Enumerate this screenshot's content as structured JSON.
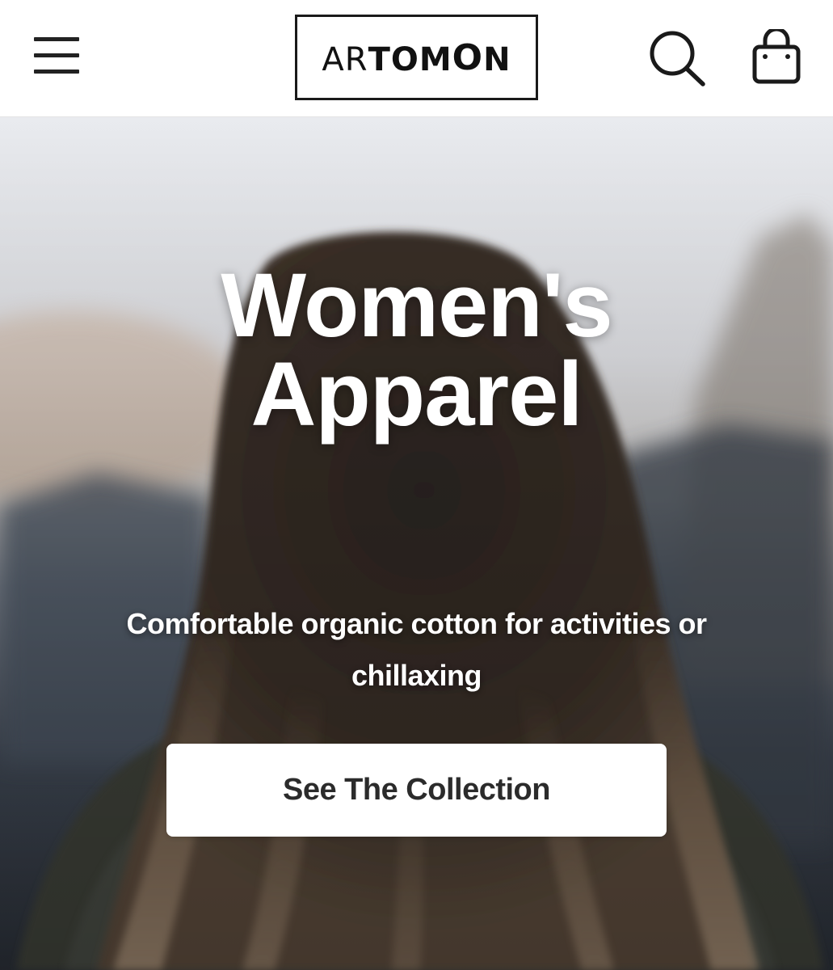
{
  "header": {
    "menu_icon": "hamburger-menu-icon",
    "logo": {
      "text": "ARTOMON",
      "parts": [
        "AR",
        "TOM",
        "O",
        "N"
      ]
    },
    "search_icon": "search-icon",
    "cart_icon": "shopping-bag-icon"
  },
  "hero": {
    "title_line1": "Women's",
    "title_line2": "Apparel",
    "subtitle": "Comfortable organic cotton for activities or chillaxing",
    "cta_label": "See The Collection"
  },
  "colors": {
    "header_bg": "#ffffff",
    "text_dark": "#222222",
    "hero_text": "#ffffff",
    "button_bg": "#ffffff",
    "button_text": "#2b2b2b"
  }
}
